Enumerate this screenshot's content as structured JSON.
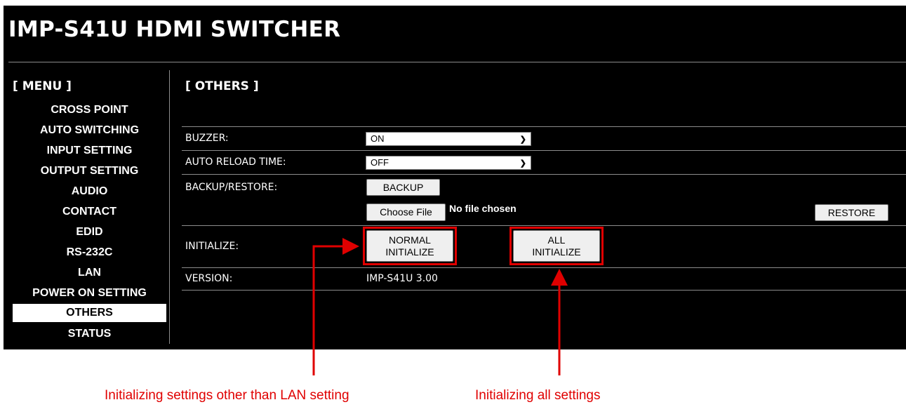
{
  "header": {
    "title": "IMP-S41U HDMI SWITCHER"
  },
  "menu": {
    "title": "[ MENU ]",
    "items": [
      {
        "label": "CROSS POINT"
      },
      {
        "label": "AUTO SWITCHING"
      },
      {
        "label": "INPUT SETTING"
      },
      {
        "label": "OUTPUT SETTING"
      },
      {
        "label": "AUDIO"
      },
      {
        "label": "CONTACT"
      },
      {
        "label": "EDID"
      },
      {
        "label": "RS-232C"
      },
      {
        "label": "LAN"
      },
      {
        "label": "POWER ON SETTING"
      },
      {
        "label": "OTHERS",
        "active": true
      },
      {
        "label": "STATUS"
      }
    ]
  },
  "main": {
    "section_title": "[ OTHERS ]",
    "buzzer": {
      "label": "BUZZER:",
      "value": "ON"
    },
    "auto_reload": {
      "label": "AUTO RELOAD TIME:",
      "value": "OFF"
    },
    "backup_restore": {
      "label": "BACKUP/RESTORE:",
      "backup_button": "BACKUP",
      "choose_file_button": "Choose File",
      "file_status": "No file chosen",
      "restore_button": "RESTORE"
    },
    "initialize": {
      "label": "INITIALIZE:",
      "normal_line1": "NORMAL",
      "normal_line2": "INITIALIZE",
      "all_line1": "ALL",
      "all_line2": "INITIALIZE"
    },
    "version": {
      "label": "VERSION:",
      "value": "IMP-S41U 3.00"
    }
  },
  "annotations": {
    "normal_note": "Initializing settings other than LAN setting",
    "all_note": "Initializing all settings",
    "color": "#e00000"
  }
}
